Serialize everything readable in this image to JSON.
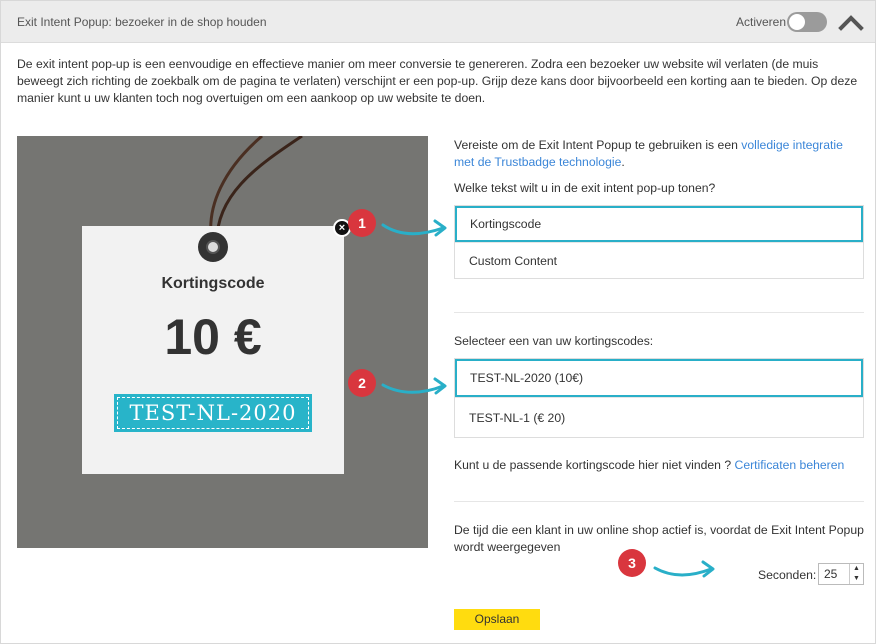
{
  "header": {
    "title": "Exit Intent Popup: bezoeker in de shop houden",
    "activate_label": "Activeren",
    "toggle_on": false
  },
  "intro": "De exit intent pop-up is een eenvoudige en effectieve manier om meer conversie te genereren. Zodra een bezoeker uw website wil verlaten (de muis beweegt zich richting de zoekbalk om de pagina te verlaten) verschijnt er een pop-up. Grijp deze kans door bijvoorbeeld een korting aan te bieden. Op deze manier kunt u uw klanten toch nog overtuigen om een aankoop op uw website te doen.",
  "preview": {
    "tag_title": "Kortingscode",
    "tag_amount": "10 €",
    "tag_code": "TEST-NL-2020",
    "close_glyph": "×"
  },
  "requirement": {
    "text_before": "Vereiste om de Exit Intent Popup te gebruiken is een ",
    "link": "volledige integratie met de Trustbadge technologie",
    "text_after": "."
  },
  "question": "Welke tekst wilt u in de exit intent pop-up tonen?",
  "content_options": [
    {
      "label": "Kortingscode",
      "selected": true
    },
    {
      "label": "Custom Content",
      "selected": false
    }
  ],
  "select_label": "Selecteer een van uw kortingscodes:",
  "code_options": [
    {
      "label": "TEST-NL-2020 (10€)",
      "selected": true
    },
    {
      "label": "TEST-NL-1 (€ 20)",
      "selected": false
    }
  ],
  "not_found": {
    "text": "Kunt u de passende kortingscode hier niet vinden ? ",
    "link": "Certificaten beheren"
  },
  "time_text": "De tijd die een klant in uw online shop actief is, voordat de Exit Intent Popup wordt weergegeven",
  "seconds": {
    "label": "Seconden:",
    "value": "25"
  },
  "save_label": "Opslaan",
  "badges": [
    "1",
    "2",
    "3"
  ],
  "colors": {
    "accent": "#29afc8",
    "badge": "#d9363e",
    "button": "#ffdc0f",
    "link": "#3b86d8"
  }
}
